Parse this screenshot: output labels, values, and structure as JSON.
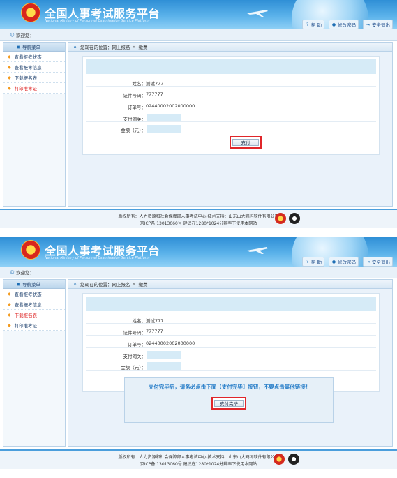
{
  "header": {
    "title": "全国人事考试服务平台",
    "subtitle": "National Ministry of Personnel Examination Service Platform",
    "links": [
      {
        "label": "帮 助",
        "icon": "help-icon"
      },
      {
        "label": "修改密码",
        "icon": "password-icon"
      },
      {
        "label": "安全退出",
        "icon": "logout-icon"
      }
    ]
  },
  "welcome": "欢迎您：",
  "sidebar": {
    "heading": "导航菜单",
    "items": [
      "查看报考状态",
      "查看报考信息",
      "下载报名表",
      "打印准考证"
    ]
  },
  "breadcrumb": {
    "prefix": "您现在的位置：网上报名",
    "separator": "»",
    "current": "缴费"
  },
  "form": {
    "name_label": "姓名：",
    "name_value": "测试777",
    "id_label": "证件号码：",
    "id_value": "777777",
    "order_label": "订单号：",
    "order_value": "0244000200200000​0",
    "gateway_label": "支付网关：",
    "amount_label": "金额（元）："
  },
  "pay_button": "支付",
  "overlay": {
    "message": "支付完毕后，请务必点击下面【支付完毕】按钮，不要点击其他链接！",
    "done_button": "支付完毕"
  },
  "footer": {
    "line1": "版权所有：人力资源和社会保障部人事考试中心  技术支持：山东山大鸥玛软件有限公司",
    "line2": "京ICP备 13013060号  建议在1280*1024分辨率下使用本网站"
  },
  "colors": {
    "header": "#3b9be0",
    "accent_red": "#e0262a",
    "link_blue": "#1f4e8c",
    "overlay_text": "#2a7fc9"
  }
}
